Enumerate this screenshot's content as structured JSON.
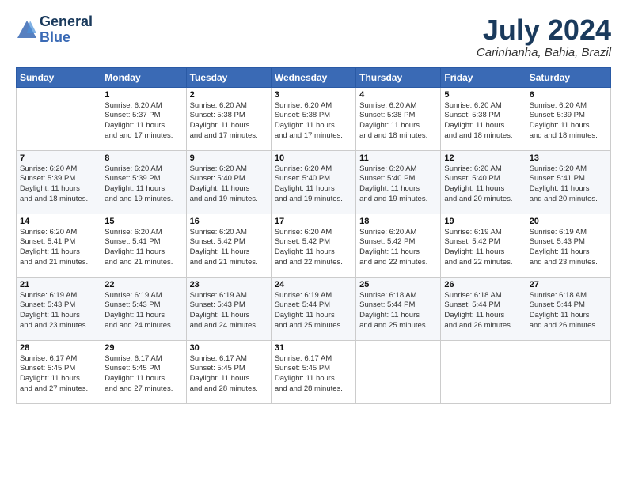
{
  "header": {
    "logo_line1": "General",
    "logo_line2": "Blue",
    "month_title": "July 2024",
    "location": "Carinhanha, Bahia, Brazil"
  },
  "days_of_week": [
    "Sunday",
    "Monday",
    "Tuesday",
    "Wednesday",
    "Thursday",
    "Friday",
    "Saturday"
  ],
  "weeks": [
    [
      {
        "day": "",
        "sunrise": "",
        "sunset": "",
        "daylight": ""
      },
      {
        "day": "1",
        "sunrise": "Sunrise: 6:20 AM",
        "sunset": "Sunset: 5:37 PM",
        "daylight": "Daylight: 11 hours and 17 minutes."
      },
      {
        "day": "2",
        "sunrise": "Sunrise: 6:20 AM",
        "sunset": "Sunset: 5:38 PM",
        "daylight": "Daylight: 11 hours and 17 minutes."
      },
      {
        "day": "3",
        "sunrise": "Sunrise: 6:20 AM",
        "sunset": "Sunset: 5:38 PM",
        "daylight": "Daylight: 11 hours and 17 minutes."
      },
      {
        "day": "4",
        "sunrise": "Sunrise: 6:20 AM",
        "sunset": "Sunset: 5:38 PM",
        "daylight": "Daylight: 11 hours and 18 minutes."
      },
      {
        "day": "5",
        "sunrise": "Sunrise: 6:20 AM",
        "sunset": "Sunset: 5:38 PM",
        "daylight": "Daylight: 11 hours and 18 minutes."
      },
      {
        "day": "6",
        "sunrise": "Sunrise: 6:20 AM",
        "sunset": "Sunset: 5:39 PM",
        "daylight": "Daylight: 11 hours and 18 minutes."
      }
    ],
    [
      {
        "day": "7",
        "sunrise": "Sunrise: 6:20 AM",
        "sunset": "Sunset: 5:39 PM",
        "daylight": "Daylight: 11 hours and 18 minutes."
      },
      {
        "day": "8",
        "sunrise": "Sunrise: 6:20 AM",
        "sunset": "Sunset: 5:39 PM",
        "daylight": "Daylight: 11 hours and 19 minutes."
      },
      {
        "day": "9",
        "sunrise": "Sunrise: 6:20 AM",
        "sunset": "Sunset: 5:40 PM",
        "daylight": "Daylight: 11 hours and 19 minutes."
      },
      {
        "day": "10",
        "sunrise": "Sunrise: 6:20 AM",
        "sunset": "Sunset: 5:40 PM",
        "daylight": "Daylight: 11 hours and 19 minutes."
      },
      {
        "day": "11",
        "sunrise": "Sunrise: 6:20 AM",
        "sunset": "Sunset: 5:40 PM",
        "daylight": "Daylight: 11 hours and 19 minutes."
      },
      {
        "day": "12",
        "sunrise": "Sunrise: 6:20 AM",
        "sunset": "Sunset: 5:40 PM",
        "daylight": "Daylight: 11 hours and 20 minutes."
      },
      {
        "day": "13",
        "sunrise": "Sunrise: 6:20 AM",
        "sunset": "Sunset: 5:41 PM",
        "daylight": "Daylight: 11 hours and 20 minutes."
      }
    ],
    [
      {
        "day": "14",
        "sunrise": "Sunrise: 6:20 AM",
        "sunset": "Sunset: 5:41 PM",
        "daylight": "Daylight: 11 hours and 21 minutes."
      },
      {
        "day": "15",
        "sunrise": "Sunrise: 6:20 AM",
        "sunset": "Sunset: 5:41 PM",
        "daylight": "Daylight: 11 hours and 21 minutes."
      },
      {
        "day": "16",
        "sunrise": "Sunrise: 6:20 AM",
        "sunset": "Sunset: 5:42 PM",
        "daylight": "Daylight: 11 hours and 21 minutes."
      },
      {
        "day": "17",
        "sunrise": "Sunrise: 6:20 AM",
        "sunset": "Sunset: 5:42 PM",
        "daylight": "Daylight: 11 hours and 22 minutes."
      },
      {
        "day": "18",
        "sunrise": "Sunrise: 6:20 AM",
        "sunset": "Sunset: 5:42 PM",
        "daylight": "Daylight: 11 hours and 22 minutes."
      },
      {
        "day": "19",
        "sunrise": "Sunrise: 6:19 AM",
        "sunset": "Sunset: 5:42 PM",
        "daylight": "Daylight: 11 hours and 22 minutes."
      },
      {
        "day": "20",
        "sunrise": "Sunrise: 6:19 AM",
        "sunset": "Sunset: 5:43 PM",
        "daylight": "Daylight: 11 hours and 23 minutes."
      }
    ],
    [
      {
        "day": "21",
        "sunrise": "Sunrise: 6:19 AM",
        "sunset": "Sunset: 5:43 PM",
        "daylight": "Daylight: 11 hours and 23 minutes."
      },
      {
        "day": "22",
        "sunrise": "Sunrise: 6:19 AM",
        "sunset": "Sunset: 5:43 PM",
        "daylight": "Daylight: 11 hours and 24 minutes."
      },
      {
        "day": "23",
        "sunrise": "Sunrise: 6:19 AM",
        "sunset": "Sunset: 5:43 PM",
        "daylight": "Daylight: 11 hours and 24 minutes."
      },
      {
        "day": "24",
        "sunrise": "Sunrise: 6:19 AM",
        "sunset": "Sunset: 5:44 PM",
        "daylight": "Daylight: 11 hours and 25 minutes."
      },
      {
        "day": "25",
        "sunrise": "Sunrise: 6:18 AM",
        "sunset": "Sunset: 5:44 PM",
        "daylight": "Daylight: 11 hours and 25 minutes."
      },
      {
        "day": "26",
        "sunrise": "Sunrise: 6:18 AM",
        "sunset": "Sunset: 5:44 PM",
        "daylight": "Daylight: 11 hours and 26 minutes."
      },
      {
        "day": "27",
        "sunrise": "Sunrise: 6:18 AM",
        "sunset": "Sunset: 5:44 PM",
        "daylight": "Daylight: 11 hours and 26 minutes."
      }
    ],
    [
      {
        "day": "28",
        "sunrise": "Sunrise: 6:17 AM",
        "sunset": "Sunset: 5:45 PM",
        "daylight": "Daylight: 11 hours and 27 minutes."
      },
      {
        "day": "29",
        "sunrise": "Sunrise: 6:17 AM",
        "sunset": "Sunset: 5:45 PM",
        "daylight": "Daylight: 11 hours and 27 minutes."
      },
      {
        "day": "30",
        "sunrise": "Sunrise: 6:17 AM",
        "sunset": "Sunset: 5:45 PM",
        "daylight": "Daylight: 11 hours and 28 minutes."
      },
      {
        "day": "31",
        "sunrise": "Sunrise: 6:17 AM",
        "sunset": "Sunset: 5:45 PM",
        "daylight": "Daylight: 11 hours and 28 minutes."
      },
      {
        "day": "",
        "sunrise": "",
        "sunset": "",
        "daylight": ""
      },
      {
        "day": "",
        "sunrise": "",
        "sunset": "",
        "daylight": ""
      },
      {
        "day": "",
        "sunrise": "",
        "sunset": "",
        "daylight": ""
      }
    ]
  ]
}
